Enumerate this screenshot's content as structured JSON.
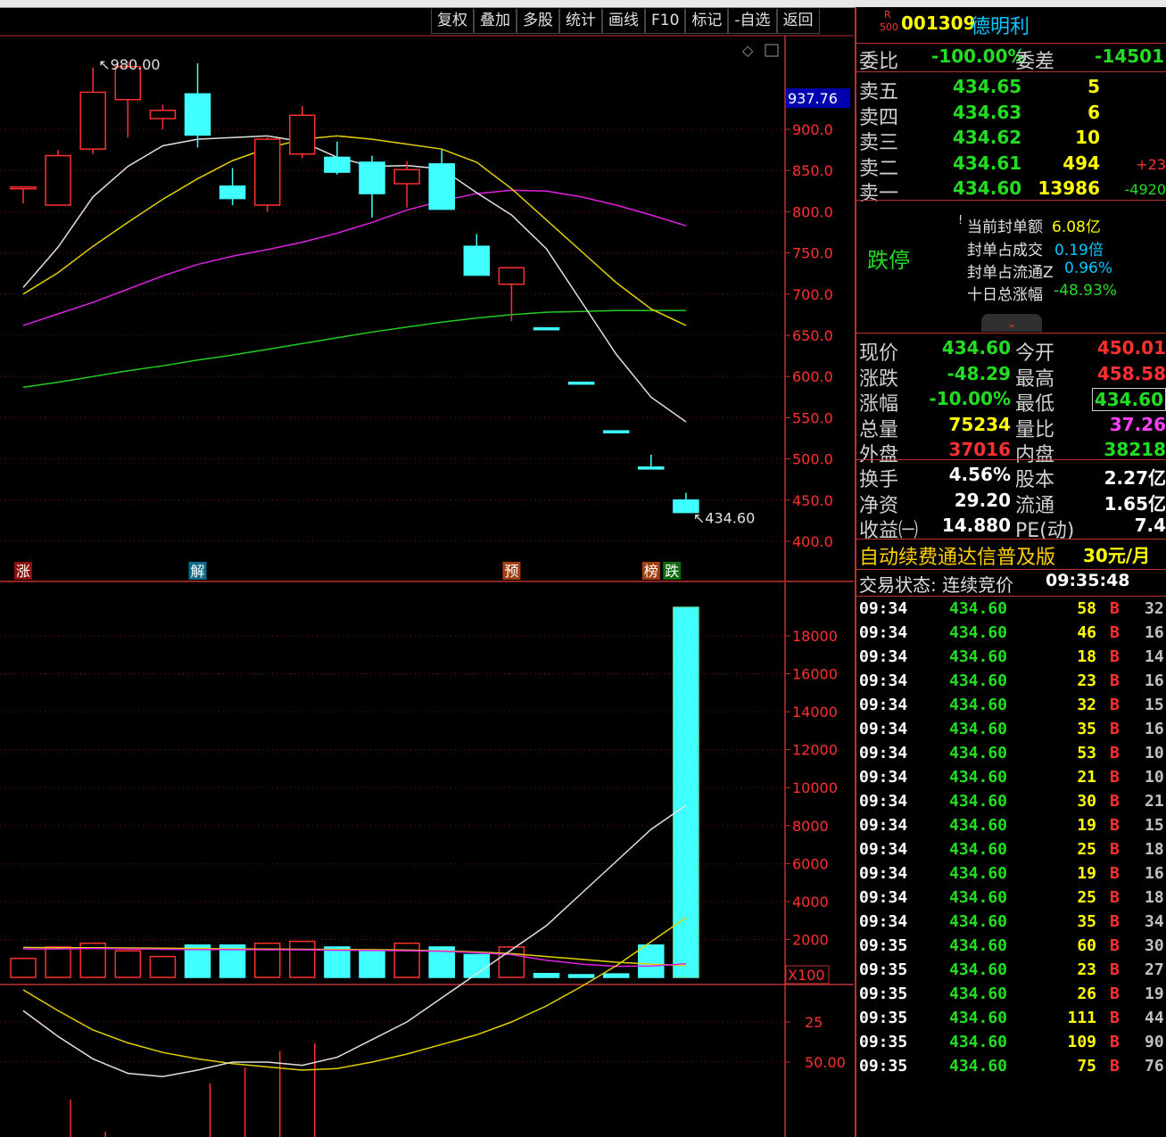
{
  "toolbar": [
    "复权",
    "叠加",
    "多股",
    "统计",
    "画线",
    "F10",
    "标记",
    "-自选",
    "返回"
  ],
  "stock": {
    "badge_top": "R",
    "badge_bottom": "500",
    "code": "001309",
    "name": "德明利"
  },
  "weibi": {
    "label": "委比",
    "value": "-100.00%",
    "diff_label": "委差",
    "diff_value": "-14501"
  },
  "asks": [
    {
      "label": "卖五",
      "price": "434.65",
      "volume": "5",
      "change": ""
    },
    {
      "label": "卖四",
      "price": "434.63",
      "volume": "6",
      "change": ""
    },
    {
      "label": "卖三",
      "price": "434.62",
      "volume": "10",
      "change": ""
    },
    {
      "label": "卖二",
      "price": "434.61",
      "volume": "494",
      "change": "+23"
    },
    {
      "label": "卖一",
      "price": "434.60",
      "volume": "13986",
      "change": "-4920"
    }
  ],
  "limit": {
    "status": "跌停",
    "l1_label": "当前封单额",
    "l1_value": "6.08亿",
    "l2_label": "封单占成交",
    "l2_value": "0.19倍",
    "l3_label": "封单占流通Z",
    "l3_value": "0.96%",
    "l4_label": "十日总涨幅",
    "l4_value": "-48.93%"
  },
  "quote": {
    "now_label": "现价",
    "now": "434.60",
    "open_label": "今开",
    "open": "450.01",
    "chg_label": "涨跌",
    "chg": "-48.29",
    "high_label": "最高",
    "high": "458.58",
    "pct_label": "涨幅",
    "pct": "-10.00%",
    "low_label": "最低",
    "low": "434.60",
    "vol_label": "总量",
    "vol": "75234",
    "ratio_label": "量比",
    "ratio": "37.26",
    "out_label": "外盘",
    "out": "37016",
    "in_label": "内盘",
    "in": "38218"
  },
  "fund": {
    "turn_label": "换手",
    "turn": "4.56%",
    "share_label": "股本",
    "share": "2.27亿",
    "nav_label": "净资",
    "nav": "29.20",
    "float_label": "流通",
    "float": "1.65亿",
    "eps_label": "收益㈠",
    "eps": "14.880",
    "pe_label": "PE(动)",
    "pe": "7.4"
  },
  "ad": {
    "text": "自动续费通达信普及版",
    "price": "30元/月"
  },
  "trade_status": {
    "label": "交易状态: 连续竞价",
    "time": "09:35:48"
  },
  "ticks": [
    [
      "09:34",
      "434.60",
      "58",
      "B",
      "32"
    ],
    [
      "09:34",
      "434.60",
      "46",
      "B",
      "16"
    ],
    [
      "09:34",
      "434.60",
      "18",
      "B",
      "14"
    ],
    [
      "09:34",
      "434.60",
      "23",
      "B",
      "16"
    ],
    [
      "09:34",
      "434.60",
      "32",
      "B",
      "15"
    ],
    [
      "09:34",
      "434.60",
      "35",
      "B",
      "16"
    ],
    [
      "09:34",
      "434.60",
      "53",
      "B",
      "10"
    ],
    [
      "09:34",
      "434.60",
      "21",
      "B",
      "10"
    ],
    [
      "09:34",
      "434.60",
      "30",
      "B",
      "21"
    ],
    [
      "09:34",
      "434.60",
      "19",
      "B",
      "15"
    ],
    [
      "09:34",
      "434.60",
      "25",
      "B",
      "18"
    ],
    [
      "09:34",
      "434.60",
      "19",
      "B",
      "16"
    ],
    [
      "09:34",
      "434.60",
      "25",
      "B",
      "18"
    ],
    [
      "09:34",
      "434.60",
      "35",
      "B",
      "34"
    ],
    [
      "09:35",
      "434.60",
      "60",
      "B",
      "30"
    ],
    [
      "09:35",
      "434.60",
      "23",
      "B",
      "27"
    ],
    [
      "09:35",
      "434.60",
      "26",
      "B",
      "19"
    ],
    [
      "09:35",
      "434.60",
      "111",
      "B",
      "44"
    ],
    [
      "09:35",
      "434.60",
      "109",
      "B",
      "90"
    ],
    [
      "09:35",
      "434.60",
      "75",
      "B",
      "76"
    ]
  ],
  "chart_data": {
    "type": "candlestick",
    "price_axis": {
      "ticks": [
        "900.0",
        "850.0",
        "800.0",
        "750.0",
        "700.0",
        "650.0",
        "600.0",
        "550.0",
        "500.0",
        "450.0",
        "400.0"
      ],
      "range": [
        400,
        980
      ]
    },
    "price_marker": "937.76",
    "high_label": "980.00",
    "last_label": "434.60",
    "candles": [
      {
        "o": 830,
        "c": 830,
        "h": 830,
        "l": 810,
        "up": true
      },
      {
        "o": 808,
        "c": 868,
        "h": 875,
        "l": 808,
        "up": true
      },
      {
        "o": 876,
        "c": 945,
        "h": 975,
        "l": 870,
        "up": true
      },
      {
        "o": 936,
        "c": 976,
        "h": 982,
        "l": 890,
        "up": true
      },
      {
        "o": 913,
        "c": 923,
        "h": 930,
        "l": 900,
        "up": true
      },
      {
        "o": 943,
        "c": 893,
        "h": 980,
        "l": 878,
        "up": false
      },
      {
        "o": 831,
        "c": 816,
        "h": 853,
        "l": 808,
        "up": false
      },
      {
        "o": 808,
        "c": 888,
        "h": 892,
        "l": 800,
        "up": true
      },
      {
        "o": 870,
        "c": 917,
        "h": 928,
        "l": 865,
        "up": true
      },
      {
        "o": 866,
        "c": 848,
        "h": 885,
        "l": 845,
        "up": false
      },
      {
        "o": 860,
        "c": 822,
        "h": 868,
        "l": 793,
        "up": false
      },
      {
        "o": 834,
        "c": 851,
        "h": 861,
        "l": 805,
        "up": true
      },
      {
        "o": 858,
        "c": 803,
        "h": 875,
        "l": 803,
        "up": false
      },
      {
        "o": 758,
        "c": 723,
        "h": 773,
        "l": 723,
        "up": false
      },
      {
        "o": 712,
        "c": 732,
        "h": 732,
        "l": 667,
        "up": true
      },
      {
        "o": 659,
        "c": 659,
        "h": 659,
        "l": 659,
        "up": false
      },
      {
        "o": 593,
        "c": 593,
        "h": 593,
        "l": 593,
        "up": false
      },
      {
        "o": 534,
        "c": 534,
        "h": 534,
        "l": 534,
        "up": false
      },
      {
        "o": 490,
        "c": 490,
        "h": 505,
        "l": 490,
        "up": false
      },
      {
        "o": 450,
        "c": 435,
        "h": 459,
        "l": 435,
        "up": false
      }
    ],
    "ma_white": [
      708,
      757,
      818,
      855,
      880,
      888,
      890,
      892,
      885,
      866,
      855,
      856,
      852,
      823,
      796,
      755,
      691,
      627,
      575,
      545
    ],
    "ma_yellow": [
      700,
      726,
      758,
      787,
      815,
      840,
      862,
      877,
      888,
      892,
      888,
      882,
      876,
      860,
      828,
      790,
      752,
      714,
      682,
      662
    ],
    "ma_magenta": [
      662,
      676,
      690,
      706,
      722,
      736,
      746,
      754,
      763,
      774,
      787,
      802,
      813,
      822,
      826,
      825,
      818,
      808,
      796,
      783
    ],
    "ma_green": [
      587,
      593,
      600,
      607,
      613,
      620,
      626,
      633,
      640,
      647,
      654,
      660,
      666,
      671,
      675,
      678,
      679,
      680,
      680,
      680
    ],
    "markers": [
      "涨",
      "解",
      "预",
      "榜",
      "跌"
    ],
    "volume_axis": {
      "ticks": [
        "18000",
        "16000",
        "14000",
        "12000",
        "10000",
        "8000",
        "6000",
        "4000",
        "2000"
      ],
      "unit": "X100"
    },
    "volume": [
      1000,
      1600,
      1800,
      1400,
      1100,
      1700,
      1700,
      1800,
      1900,
      1600,
      1400,
      1800,
      1600,
      1200,
      1600,
      200,
      140,
      180,
      1700,
      19500
    ],
    "vol_ma1": [
      1500,
      1500,
      1520,
      1500,
      1480,
      1460,
      1460,
      1450,
      1450,
      1430,
      1420,
      1400,
      1380,
      1300,
      1200,
      900,
      700,
      580,
      600,
      720
    ],
    "vol_ma2": [
      1580,
      1560,
      1560,
      1550,
      1540,
      1520,
      1500,
      1490,
      1480,
      1470,
      1460,
      1440,
      1400,
      1340,
      1250,
      1100,
      950,
      800,
      700,
      620
    ],
    "ind_axis": {
      "ticks": [
        "50.00",
        "25"
      ]
    },
    "ind_white": [
      18,
      34,
      48,
      57,
      59,
      55,
      50,
      50,
      52,
      47,
      36,
      25,
      10,
      -5,
      -20,
      -35,
      -55,
      -75,
      -95,
      -110
    ],
    "ind_yellow": [
      5,
      18,
      30,
      38,
      44,
      48,
      51,
      53,
      55,
      54,
      50,
      45,
      39,
      33,
      25,
      15,
      3,
      -10,
      -25,
      -40
    ],
    "ind_bars": [
      -20,
      40,
      60,
      70,
      75,
      30,
      20,
      10,
      5,
      -5,
      -10,
      -20,
      -30,
      -40,
      -50,
      -60,
      -70,
      -80,
      -90,
      -100
    ]
  }
}
